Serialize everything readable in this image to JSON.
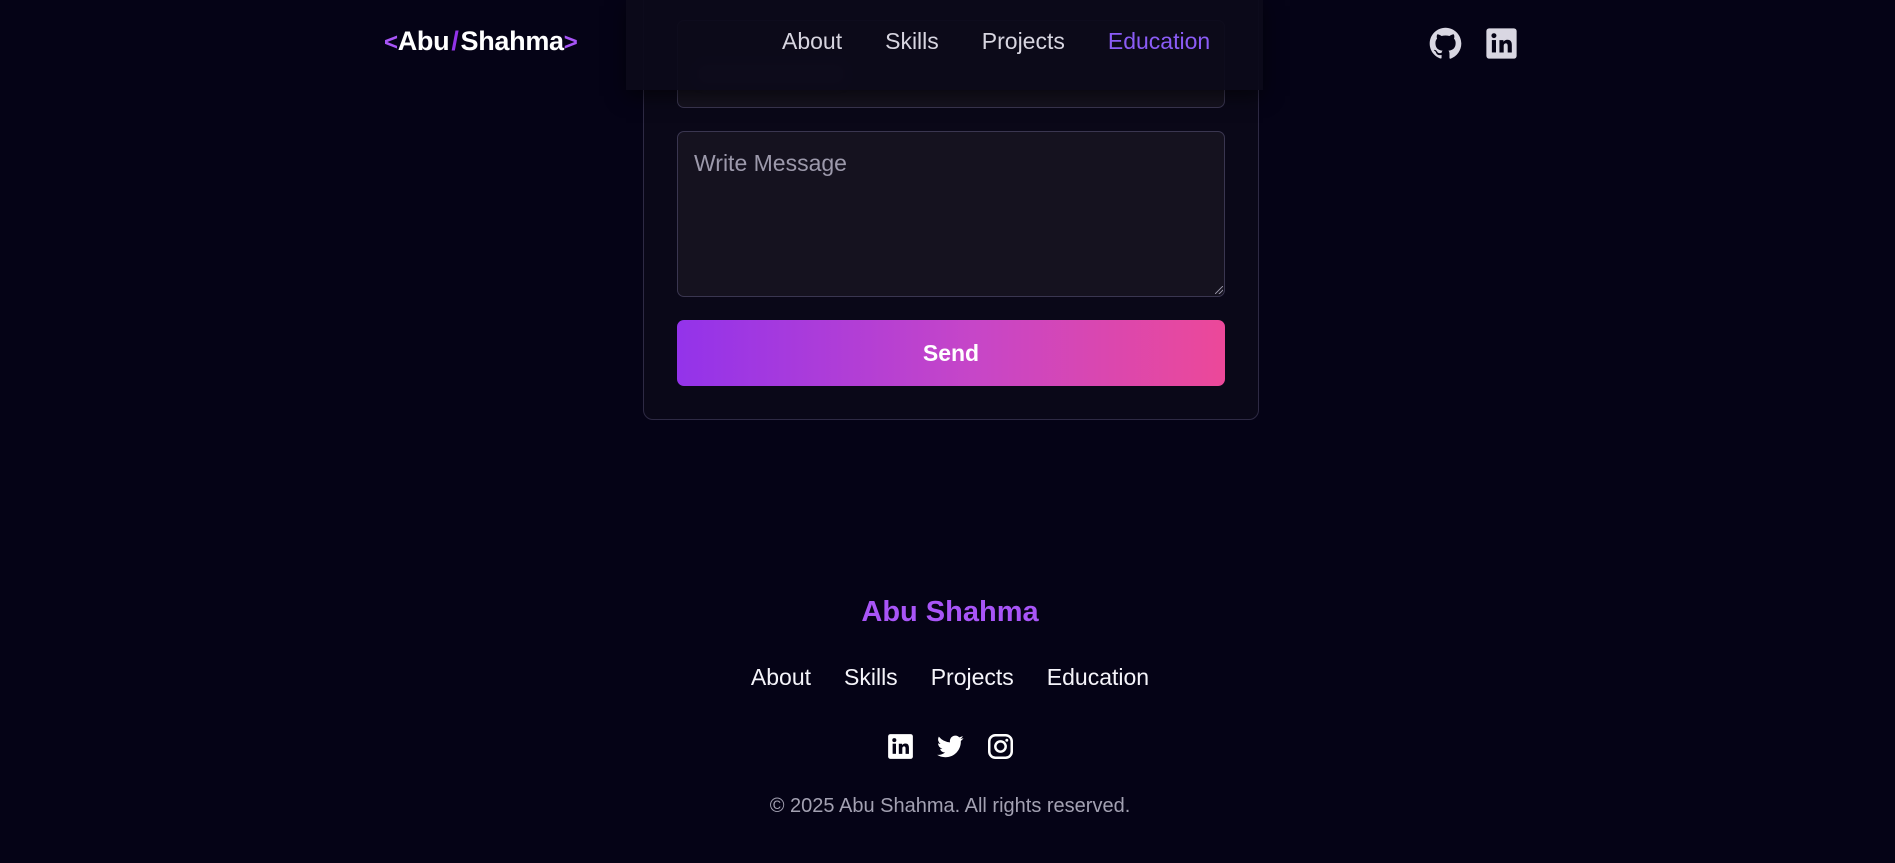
{
  "header": {
    "logo": {
      "open_bracket": "<",
      "first": "Abu",
      "slash": "/",
      "second": "Shahma",
      "close_bracket": ">"
    },
    "nav": [
      {
        "label": "About",
        "active": false
      },
      {
        "label": "Skills",
        "active": false
      },
      {
        "label": "Projects",
        "active": false
      },
      {
        "label": "Education",
        "active": true
      }
    ],
    "social_icons": [
      "github-icon",
      "linkedin-icon"
    ]
  },
  "contact_form": {
    "message_placeholder": "Write Message",
    "send_label": "Send"
  },
  "footer": {
    "name": "Abu Shahma",
    "nav": [
      "About",
      "Skills",
      "Projects",
      "Education"
    ],
    "social_icons": [
      "linkedin-icon",
      "twitter-icon",
      "instagram-icon"
    ],
    "copyright": "© 2025 Abu Shahma. All rights reserved."
  },
  "colors": {
    "background": "#050316",
    "accent": "#a855f7",
    "active_nav": "#8b5cf6",
    "button_gradient_start": "#9333ea",
    "button_gradient_end": "#ec4899"
  }
}
